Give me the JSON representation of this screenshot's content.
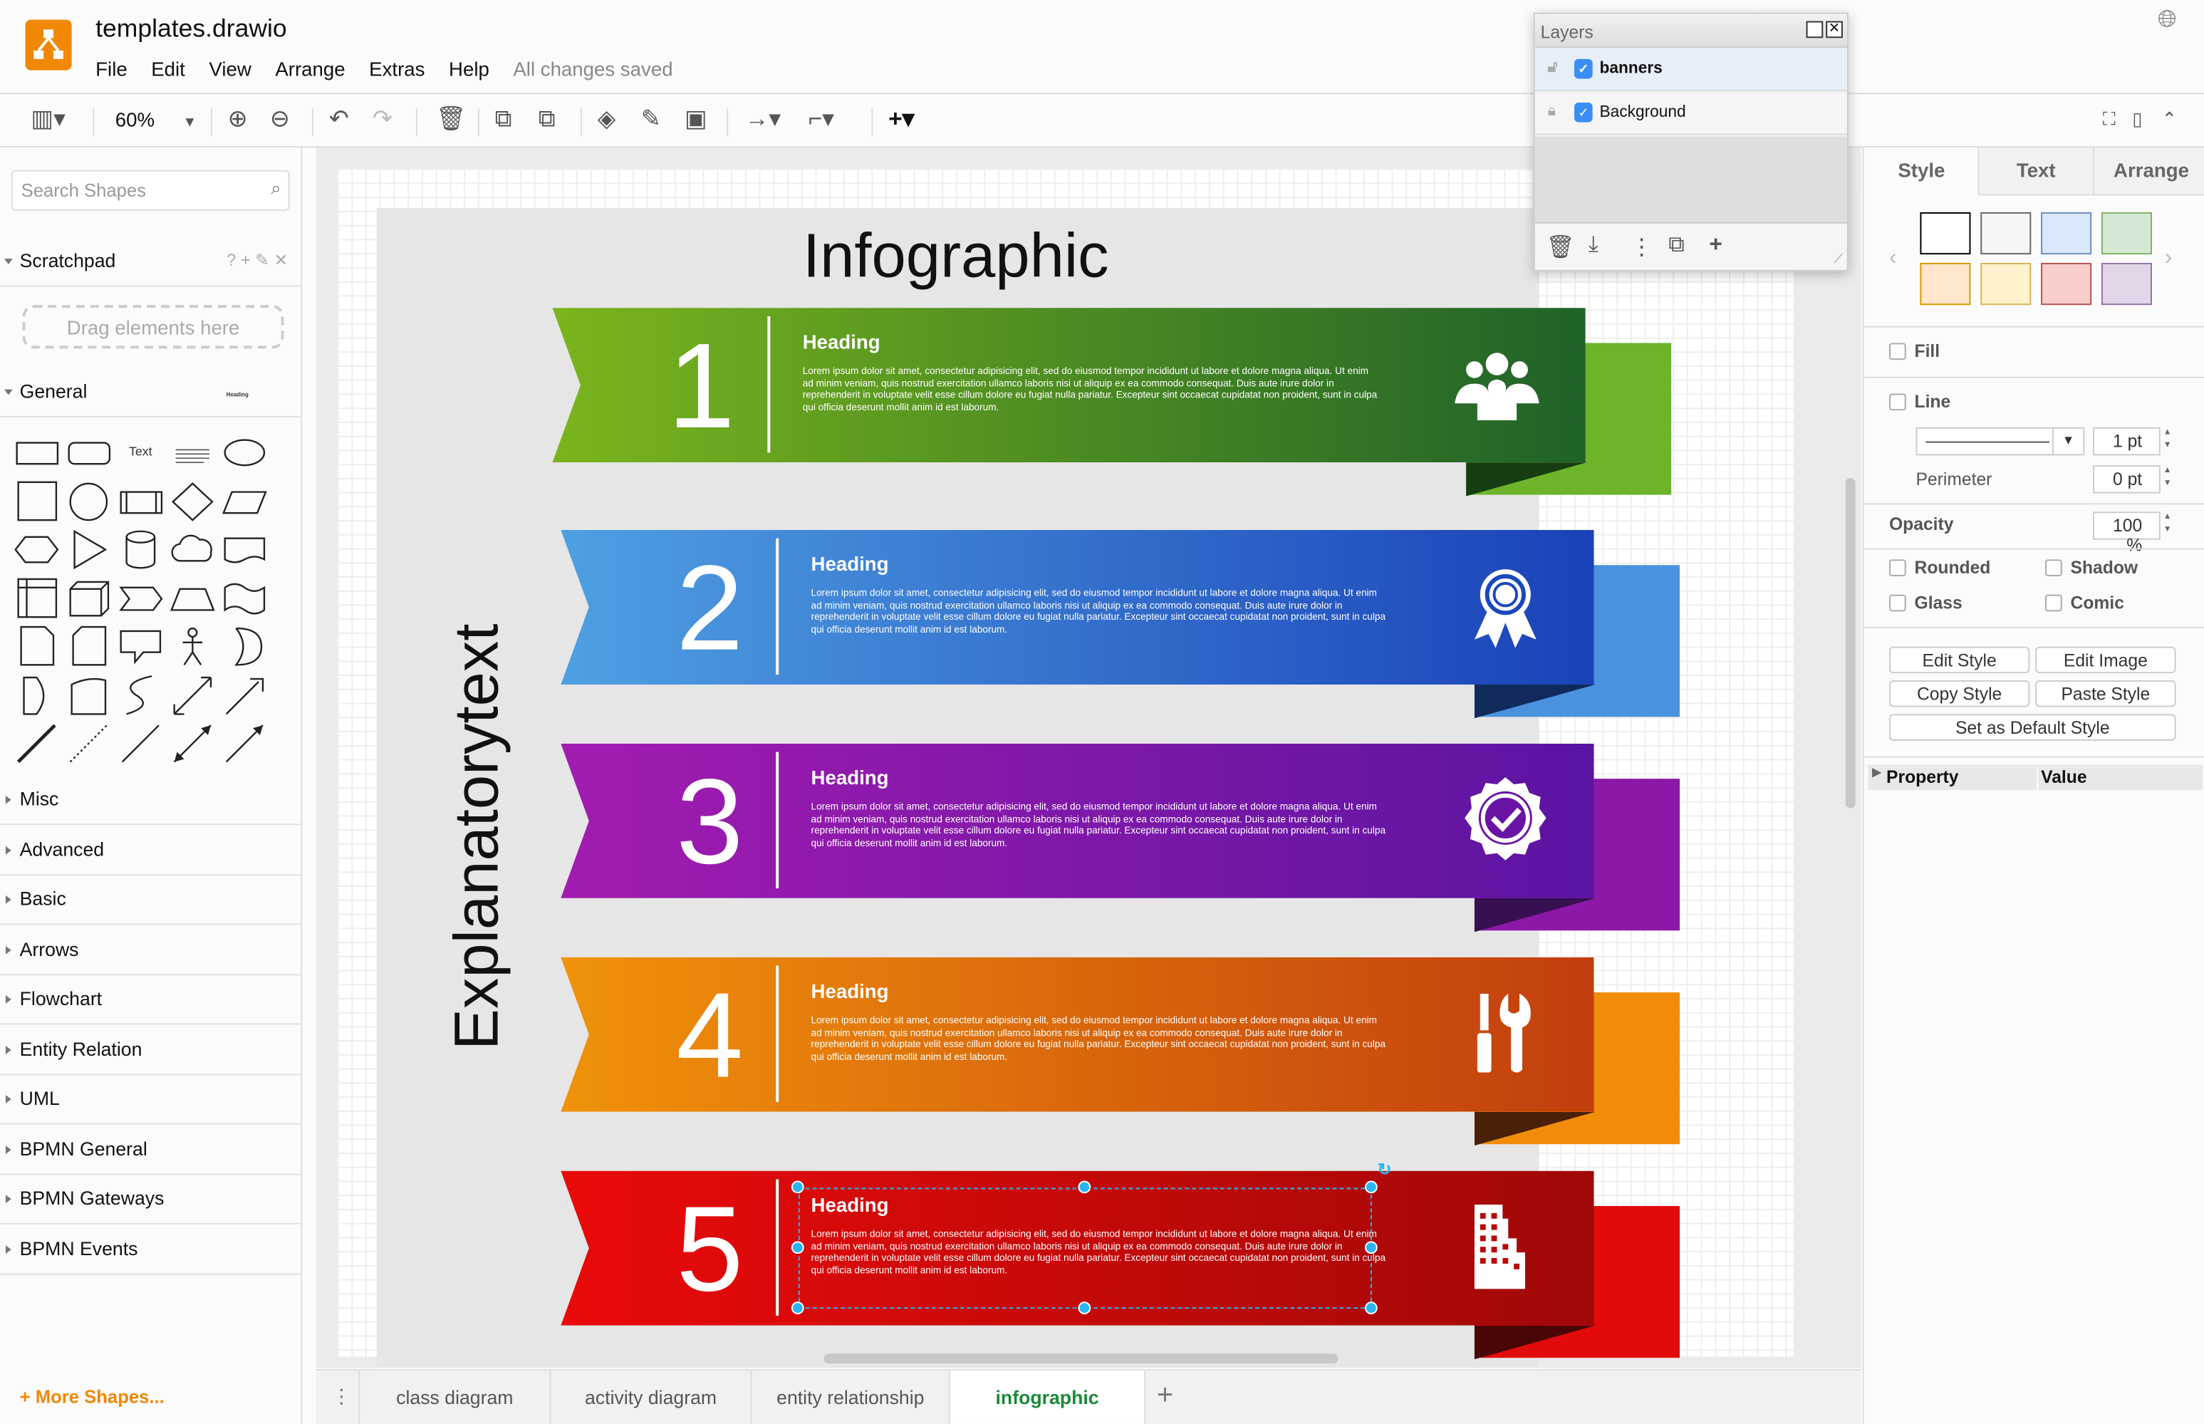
{
  "header": {
    "title": "templates.drawio",
    "menu": [
      "File",
      "Edit",
      "View",
      "Arrange",
      "Extras",
      "Help"
    ],
    "status": "All changes saved",
    "logo_color": "#f08705"
  },
  "toolbar": {
    "zoom": "60%",
    "icons": [
      "format-panel-toggle-icon",
      "zoom-in-icon",
      "zoom-out-icon",
      "undo-icon",
      "redo-icon",
      "delete-icon",
      "to-front-icon",
      "to-back-icon",
      "fill-color-icon",
      "line-color-icon",
      "shadow-icon",
      "connection-icon",
      "waypoints-icon",
      "insert-plus-icon"
    ],
    "right_icons": [
      "fullscreen-icon",
      "toggle-format-icon",
      "collapse-icon"
    ]
  },
  "sidebar": {
    "search_placeholder": "Search Shapes",
    "scratchpad": "Scratchpad",
    "scratchpad_tools": "? + ✎ ✕",
    "drag_hint": "Drag elements here",
    "general": "General",
    "shapes": [
      "rectangle",
      "rounded-rectangle",
      "text",
      "heading",
      "ellipse",
      "square",
      "circle",
      "process",
      "diamond",
      "parallelogram",
      "hexagon",
      "triangle",
      "cylinder",
      "cloud",
      "document",
      "internal-storage",
      "cube",
      "step",
      "trapezoid",
      "tape",
      "note",
      "card",
      "callout",
      "actor",
      "or",
      "data-storage",
      "manual-input",
      "curve",
      "bidirectional-arrow",
      "arrow",
      "line",
      "dotted-line",
      "plain-line",
      "bidirectional-connector",
      "directional-connector"
    ],
    "shape_text": "Text",
    "shape_heading": "Heading",
    "sections": [
      "Misc",
      "Advanced",
      "Basic",
      "Arrows",
      "Flowchart",
      "Entity Relation",
      "UML",
      "BPMN General",
      "BPMN Gateways",
      "BPMN Events"
    ],
    "more_shapes": "+ More Shapes..."
  },
  "diagram": {
    "title": "Infographic",
    "side_text": "Explanatorytext",
    "banners": [
      {
        "number": "1",
        "heading": "Heading",
        "body": "Lorem ipsum dolor sit amet, consectetur adipisicing elit, sed do eiusmod tempor incididunt ut labore et dolore magna aliqua. Ut enim ad minim veniam, quis nostrud exercitation ullamco laboris nisi ut aliquip ex ea commodo consequat. Duis aute irure dolor in reprehenderit in voluptate velit esse cillum dolore eu fugiat nulla pariatur. Excepteur sint occaecat cupidatat non proident, sunt in culpa qui officia deserunt mollit anim id est laborum.",
        "icon": "users-icon",
        "from": "#7ab51d",
        "to": "#1f6228",
        "back": "#6db42a",
        "fold": "#173d12"
      },
      {
        "number": "2",
        "heading": "Heading",
        "body": "Lorem ipsum dolor sit amet, consectetur adipisicing elit, sed do eiusmod tempor incididunt ut labore et dolore magna aliqua. Ut enim ad minim veniam, quis nostrud exercitation ullamco laboris nisi ut aliquip ex ea commodo consequat. Duis aute irure dolor in reprehenderit in voluptate velit esse cillum dolore eu fugiat nulla pariatur. Excepteur sint occaecat cupidatat non proident, sunt in culpa qui officia deserunt mollit anim id est laborum.",
        "icon": "award-ribbon-icon",
        "from": "#4f9fe2",
        "to": "#1a42b8",
        "back": "#4a92de",
        "fold": "#102a5c"
      },
      {
        "number": "3",
        "heading": "Heading",
        "body": "Lorem ipsum dolor sit amet, consectetur adipisicing elit, sed do eiusmod tempor incididunt ut labore et dolore magna aliqua. Ut enim ad minim veniam, quis nostrud exercitation ullamco laboris nisi ut aliquip ex ea commodo consequat. Duis aute irure dolor in reprehenderit in voluptate velit esse cillum dolore eu fugiat nulla pariatur. Excepteur sint occaecat cupidatat non proident, sunt in culpa qui officia deserunt mollit anim id est laborum.",
        "icon": "check-badge-icon",
        "from": "#a21cb0",
        "to": "#5b14a2",
        "back": "#8c18a8",
        "fold": "#361050"
      },
      {
        "number": "4",
        "heading": "Heading",
        "body": "Lorem ipsum dolor sit amet, consectetur adipisicing elit, sed do eiusmod tempor incididunt ut labore et dolore magna aliqua. Ut enim ad minim veniam, quis nostrud exercitation ullamco laboris nisi ut aliquip ex ea commodo consequat. Duis aute irure dolor in reprehenderit in voluptate velit esse cillum dolore eu fugiat nulla pariatur. Excepteur sint occaecat cupidatat non proident, sunt in culpa qui officia deserunt mollit anim id est laborum.",
        "icon": "tools-icon",
        "from": "#f0920a",
        "to": "#c23e0e",
        "back": "#f08c0a",
        "fold": "#4a2008"
      },
      {
        "number": "5",
        "heading": "Heading",
        "body": "Lorem ipsum dolor sit amet, consectetur adipisicing elit, sed do eiusmod tempor incididunt ut labore et dolore magna aliqua. Ut enim ad minim veniam, quis nostrud exercitation ullamco laboris nisi ut aliquip ex ea commodo consequat. Duis aute irure dolor in reprehenderit in voluptate velit esse cillum dolore eu fugiat nulla pariatur. Excepteur sint occaecat cupidatat non proident, sunt in culpa qui officia deserunt mollit anim id est laborum.",
        "icon": "building-icon",
        "from": "#ea0a0a",
        "to": "#a00808",
        "back": "#e20a0a",
        "fold": "#4a0606"
      }
    ],
    "selected_banner": "5"
  },
  "page_tabs": {
    "items": [
      "class diagram",
      "activity diagram",
      "entity relationship",
      "infographic"
    ],
    "active": "infographic",
    "add": "+"
  },
  "layers": {
    "title": "Layers",
    "items": [
      {
        "name": "banners",
        "selected": true,
        "visible": true,
        "locked": false
      },
      {
        "name": "Background",
        "selected": false,
        "visible": true,
        "locked": true
      }
    ],
    "tools": [
      "delete-layer-icon",
      "move-selection-icon",
      "more-icon",
      "duplicate-layer-icon",
      "add-layer-icon"
    ]
  },
  "format": {
    "tabs": [
      "Style",
      "Text",
      "Arrange"
    ],
    "active_tab": "Style",
    "swatches": [
      {
        "fill": "#ffffff",
        "stroke": "#000000"
      },
      {
        "fill": "#f5f5f5",
        "stroke": "#666666"
      },
      {
        "fill": "#dae8fc",
        "stroke": "#6c8ebf"
      },
      {
        "fill": "#d5e8d4",
        "stroke": "#82b366"
      },
      {
        "fill": "#ffe6cc",
        "stroke": "#d79b00"
      },
      {
        "fill": "#fff2cc",
        "stroke": "#d6b656"
      },
      {
        "fill": "#f8cecc",
        "stroke": "#b85450"
      },
      {
        "fill": "#e1d5e7",
        "stroke": "#9673a6"
      }
    ],
    "fill": "Fill",
    "line": "Line",
    "line_width": "1 pt",
    "perimeter": "Perimeter",
    "perimeter_value": "0 pt",
    "opacity": "Opacity",
    "opacity_value": "100 %",
    "rounded": "Rounded",
    "shadow": "Shadow",
    "glass": "Glass",
    "comic": "Comic",
    "buttons": {
      "edit_style": "Edit Style",
      "edit_image": "Edit Image",
      "copy_style": "Copy Style",
      "paste_style": "Paste Style",
      "default_style": "Set as Default Style"
    },
    "table": {
      "property": "Property",
      "value": "Value"
    }
  }
}
